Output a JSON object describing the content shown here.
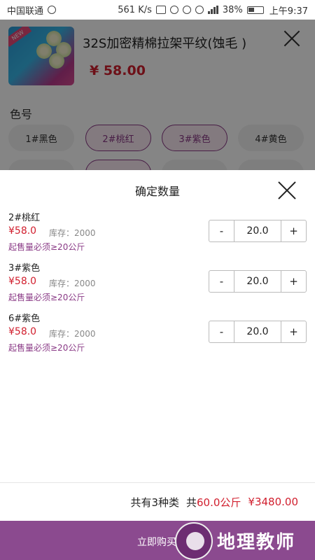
{
  "status_bar": {
    "carrier": "中国联通",
    "speed": "561 K/s",
    "battery": "38%",
    "time": "上午9:37"
  },
  "product": {
    "title": "32S加密精棉拉架平纹(蚀毛 )",
    "price": "¥ 58.00",
    "new_tag": "NEW"
  },
  "color_section": {
    "label": "色号",
    "chips": [
      {
        "label": "1#黑色",
        "selected": false
      },
      {
        "label": "2#桃红",
        "selected": true
      },
      {
        "label": "3#紫色",
        "selected": true
      },
      {
        "label": "4#黄色",
        "selected": false
      }
    ]
  },
  "modal": {
    "title": "确定数量",
    "items": [
      {
        "name": "2#桃红",
        "price": "¥58.0",
        "stock": "库存：2000",
        "note": "起售量必须≥20公斤",
        "quantity": "20.0"
      },
      {
        "name": "3#紫色",
        "price": "¥58.0",
        "stock": "库存：2000",
        "note": "起售量必须≥20公斤",
        "quantity": "20.0"
      },
      {
        "name": "6#紫色",
        "price": "¥58.0",
        "stock": "库存：2000",
        "note": "起售量必须≥20公斤",
        "quantity": "20.0"
      }
    ],
    "stepper": {
      "minus": "-",
      "plus": "+"
    },
    "summary": {
      "kinds": "共有3种类",
      "total_prefix": "共",
      "total_weight": "60.0公斤",
      "total_price": "¥3480.00"
    },
    "buy_button": "立即购买"
  },
  "watermark": {
    "text": "地理教师"
  },
  "colors": {
    "accent": "#8b4a8f",
    "price_red": "#d11f2e",
    "note_purple": "#8a3a86"
  }
}
